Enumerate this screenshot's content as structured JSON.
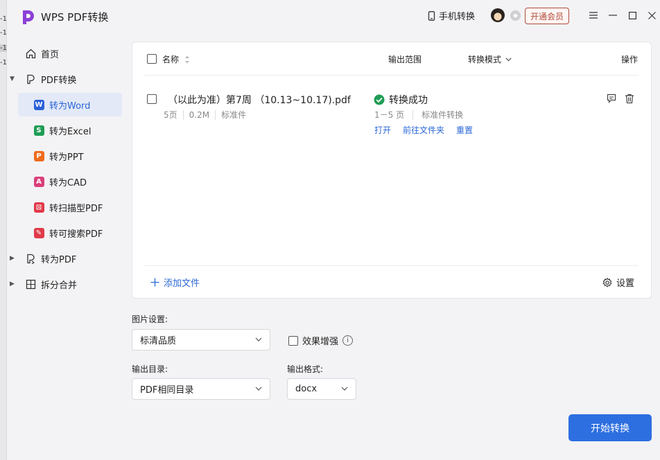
{
  "window": {
    "app_title": "WPS PDF转换",
    "mobile_label": "手机转换",
    "vip_label": "开通会员"
  },
  "edge_strip": [
    "-1",
    "-1",
    "-1",
    "-1"
  ],
  "sidebar": {
    "home": "首页",
    "pdf_convert": "PDF转换",
    "items": [
      {
        "label": "转为Word",
        "icon": "W",
        "color": "#2b62d8",
        "active": true
      },
      {
        "label": "转为Excel",
        "icon": "S",
        "color": "#1f9d55"
      },
      {
        "label": "转为PPT",
        "icon": "P",
        "color": "#ef6c1e"
      },
      {
        "label": "转为CAD",
        "icon": "A",
        "color": "#d9407a"
      },
      {
        "label": "转扫描型PDF",
        "icon": "⊡",
        "color": "#e03a4a"
      },
      {
        "label": "转可搜索PDF",
        "icon": "✎",
        "color": "#e03a4a"
      }
    ],
    "to_pdf": "转为PDF",
    "split_merge": "拆分合并"
  },
  "table": {
    "col_name": "名称",
    "col_range": "输出范围",
    "col_mode": "转换模式",
    "col_action": "操作"
  },
  "file": {
    "name": "（以此为准）第7周 （10.13~10.17).pdf",
    "pages": "5页",
    "size": "0.2M",
    "type": "标准件",
    "status": "转换成功",
    "range": "1－5 页",
    "mode": "标准件转换",
    "action_open": "打开",
    "action_folder": "前往文件夹",
    "action_reset": "重置"
  },
  "footer": {
    "add_file": "添加文件",
    "settings": "设置"
  },
  "options": {
    "image_label": "图片设置:",
    "image_value": "标清品质",
    "enhance_label": "效果增强",
    "dir_label": "输出目录:",
    "dir_value": "PDF相同目录",
    "format_label": "输出格式:",
    "format_value": "docx"
  },
  "start_button": "开始转换",
  "colors": {
    "accent": "#2d6fe0",
    "success": "#1f9d55",
    "vip": "#b0493a"
  }
}
